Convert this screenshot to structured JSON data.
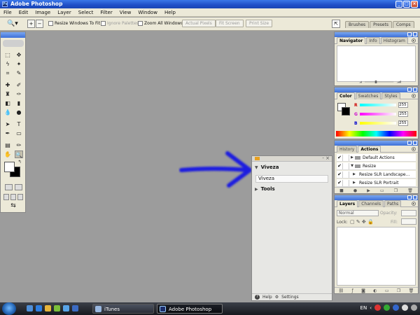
{
  "window": {
    "title": "Adobe Photoshop",
    "min": "_",
    "max": "□",
    "close": "×"
  },
  "menu": [
    "File",
    "Edit",
    "Image",
    "Layer",
    "Select",
    "Filter",
    "View",
    "Window",
    "Help"
  ],
  "options": {
    "resize_windows": "Resize Windows To Fit",
    "ignore_palettes": "Ignore Palettes",
    "zoom_all": "Zoom All Windows",
    "actual_pixels": "Actual Pixels",
    "fit_screen": "Fit Screen",
    "print_size": "Print Size",
    "well_tabs": [
      "Brushes",
      "Presets",
      "Comps"
    ]
  },
  "viveza": {
    "section1": "Viveza",
    "field_value": "Viveza",
    "section2": "Tools",
    "help": "Help",
    "settings": "Settings"
  },
  "navigator": {
    "tabs": [
      "Navigator",
      "Info",
      "Histogram"
    ]
  },
  "color": {
    "tabs": [
      "Color",
      "Swatches",
      "Styles"
    ],
    "channels": [
      {
        "label": "R",
        "value": "255"
      },
      {
        "label": "G",
        "value": "255"
      },
      {
        "label": "B",
        "value": "255"
      }
    ]
  },
  "actions": {
    "tabs": [
      "History",
      "Actions"
    ],
    "items": [
      {
        "label": "Default Actions",
        "checked": "✔"
      },
      {
        "label": "Resize",
        "checked": "✔"
      },
      {
        "label": "Resize SLR Landscape...",
        "checked": "✔"
      },
      {
        "label": "Resize SLR Portrait",
        "checked": "✔"
      }
    ]
  },
  "layers": {
    "tabs": [
      "Layers",
      "Channels",
      "Paths"
    ],
    "blend_mode": "Normal",
    "opacity_label": "Opacity:",
    "lock_label": "Lock:",
    "fill_label": "Fill:"
  },
  "taskbar": {
    "tasks": [
      "iTunes",
      "Adobe Photoshop"
    ],
    "lang": "EN"
  }
}
